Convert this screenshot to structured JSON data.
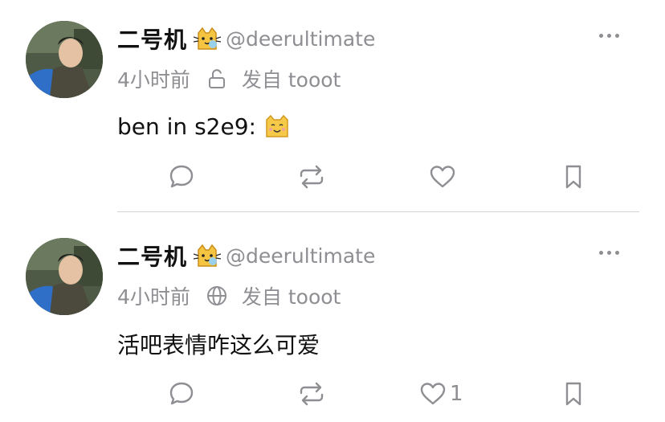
{
  "posts": [
    {
      "display_name": "二号机",
      "name_emoji": "cat-emoji-icon",
      "handle": "@deerultimate",
      "time": "4小时前",
      "visibility": "lock-icon",
      "source": "发自 tooot",
      "content": "ben in s2e9:",
      "content_emoji": "happy-cat-emoji-icon",
      "favourites_count": ""
    },
    {
      "display_name": "二号机",
      "name_emoji": "cat-emoji-icon",
      "handle": "@deerultimate",
      "time": "4小时前",
      "visibility": "globe-icon",
      "source": "发自 tooot",
      "content": "活吧表情咋这么可爱",
      "content_emoji": "",
      "favourites_count": "1"
    }
  ],
  "colors": {
    "secondary": "#8e8e93",
    "text": "#111111",
    "divider": "#d1d1d6"
  }
}
